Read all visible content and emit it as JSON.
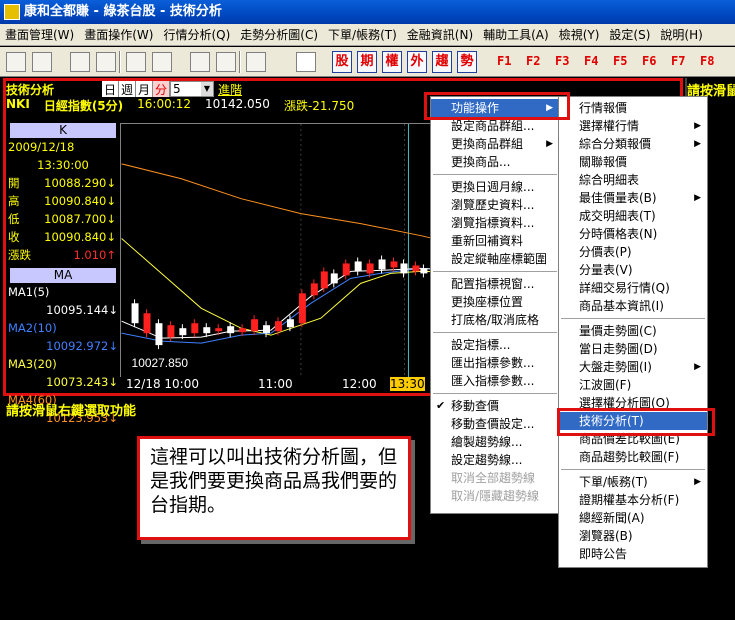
{
  "window": {
    "title": "康和全都賺 - 綠茶台股 - 技術分析"
  },
  "menubar": [
    "畫面管理(W)",
    "畫面操作(W)",
    "行情分析(Q)",
    "走勢分析圖(C)",
    "下單/帳務(T)",
    "金融資訊(N)",
    "輔助工具(A)",
    "檢視(Y)",
    "設定(S)",
    "說明(H)"
  ],
  "toolbar": {
    "red_buttons": [
      "股",
      "期",
      "權",
      "外",
      "趨",
      "勢"
    ],
    "function_keys": [
      "F1",
      "F2",
      "F3",
      "F4",
      "F5",
      "F6",
      "F7",
      "F8"
    ]
  },
  "chart_panel": {
    "title": "技術分析",
    "periods": [
      "日",
      "週",
      "月",
      "分"
    ],
    "active_period": "分",
    "combo_value": "5",
    "advanced_link": "進階",
    "symbol": "NKI",
    "name": "日經指數(5分)",
    "time": "16:00:12",
    "price": "10142.050",
    "change_label": "漲跌-21.750",
    "right_hint": "請按滑鼠"
  },
  "left_panel": {
    "k_header": "K",
    "date": "2009/12/18",
    "time": "13:30:00",
    "rows": [
      {
        "label": "開",
        "value": "10088.290",
        "arrow": "↓"
      },
      {
        "label": "高",
        "value": "10090.840",
        "arrow": "↓"
      },
      {
        "label": "低",
        "value": "10087.700",
        "arrow": "↓"
      },
      {
        "label": "收",
        "value": "10090.840",
        "arrow": "↓"
      },
      {
        "label": "漲跌",
        "value": "1.010",
        "arrow": "↑"
      }
    ],
    "ma_header": "MA",
    "ma_rows": [
      {
        "label": "MA1(5)",
        "value": "10095.144",
        "arrow": "↓",
        "color": "#ffffff"
      },
      {
        "label": "MA2(10)",
        "value": "10092.972",
        "arrow": "↓",
        "color": "#4080ff"
      },
      {
        "label": "MA3(20)",
        "value": "10073.243",
        "arrow": "↓",
        "color": "#ffff40"
      },
      {
        "label": "MA4(60)",
        "value": "10123.953",
        "arrow": "↓",
        "color": "#ff9020"
      }
    ]
  },
  "chart_data": {
    "type": "line",
    "series": [
      {
        "name": "MA1(5)",
        "color": "#ffffff"
      },
      {
        "name": "MA2(10)",
        "color": "#4080ff"
      },
      {
        "name": "MA3(20)",
        "color": "#ffff40"
      },
      {
        "name": "MA4(60)",
        "color": "#ff9020"
      }
    ],
    "x_labels": [
      "12/18 10:00",
      "11:00",
      "12:00",
      "13:30"
    ],
    "low_label": "10027.850"
  },
  "status_line": "請按滑鼠右鍵選取功能",
  "context_menu": {
    "items": [
      {
        "label": "功能操作",
        "submenu": true,
        "highlighted": true
      },
      {
        "label": "設定商品群組..."
      },
      {
        "label": "更換商品群組",
        "submenu": true
      },
      {
        "label": "更換商品..."
      },
      {
        "sep": true
      },
      {
        "label": "更換日週月線..."
      },
      {
        "label": "瀏覽歷史資料..."
      },
      {
        "label": "瀏覽指標資料..."
      },
      {
        "label": "重新回補資料"
      },
      {
        "label": "設定縱軸座標範圍"
      },
      {
        "sep": true
      },
      {
        "label": "配置指標視窗..."
      },
      {
        "label": "更換座標位置"
      },
      {
        "label": "打底格/取消底格"
      },
      {
        "sep": true
      },
      {
        "label": "設定指標..."
      },
      {
        "label": "匯出指標參數..."
      },
      {
        "label": "匯入指標參數..."
      },
      {
        "sep": true
      },
      {
        "label": "移動查價",
        "checked": true
      },
      {
        "label": "移動查價設定..."
      },
      {
        "label": "繪製趨勢線..."
      },
      {
        "label": "設定趨勢線..."
      },
      {
        "label": "取消全部趨勢線",
        "disabled": true
      },
      {
        "label": "取消/隱藏趨勢線",
        "disabled": true
      }
    ]
  },
  "submenu": {
    "items": [
      {
        "label": "行情報價"
      },
      {
        "label": "選擇權行情",
        "submenu": true
      },
      {
        "label": "綜合分類報價",
        "submenu": true
      },
      {
        "label": "關聯報價"
      },
      {
        "label": "綜合明細表"
      },
      {
        "label": "最佳價量表(B)",
        "submenu": true
      },
      {
        "label": "成交明細表(T)"
      },
      {
        "label": "分時價格表(N)"
      },
      {
        "label": "分價表(P)"
      },
      {
        "label": "分量表(V)"
      },
      {
        "label": "詳細交易行情(Q)"
      },
      {
        "label": "商品基本資訊(I)"
      },
      {
        "sep": true
      },
      {
        "label": "量價走勢圖(C)"
      },
      {
        "label": "當日走勢圖(D)"
      },
      {
        "label": "大盤走勢圖(I)",
        "submenu": true
      },
      {
        "label": "江波圖(F)"
      },
      {
        "label": "選擇權分析圖(O)"
      },
      {
        "label": "技術分析(T)",
        "highlighted": true
      },
      {
        "label": "商品價差比較圖(E)"
      },
      {
        "label": "商品趨勢比較圖(F)"
      },
      {
        "sep": true
      },
      {
        "label": "下單/帳務(T)",
        "submenu": true
      },
      {
        "label": "證期權基本分析(F)"
      },
      {
        "label": "總經新聞(A)"
      },
      {
        "label": "瀏覽器(B)"
      },
      {
        "label": "即時公告"
      }
    ]
  },
  "callout": {
    "text": "這裡可以叫出技術分析圖，但是我們要更換商品爲我們要的台指期。"
  }
}
